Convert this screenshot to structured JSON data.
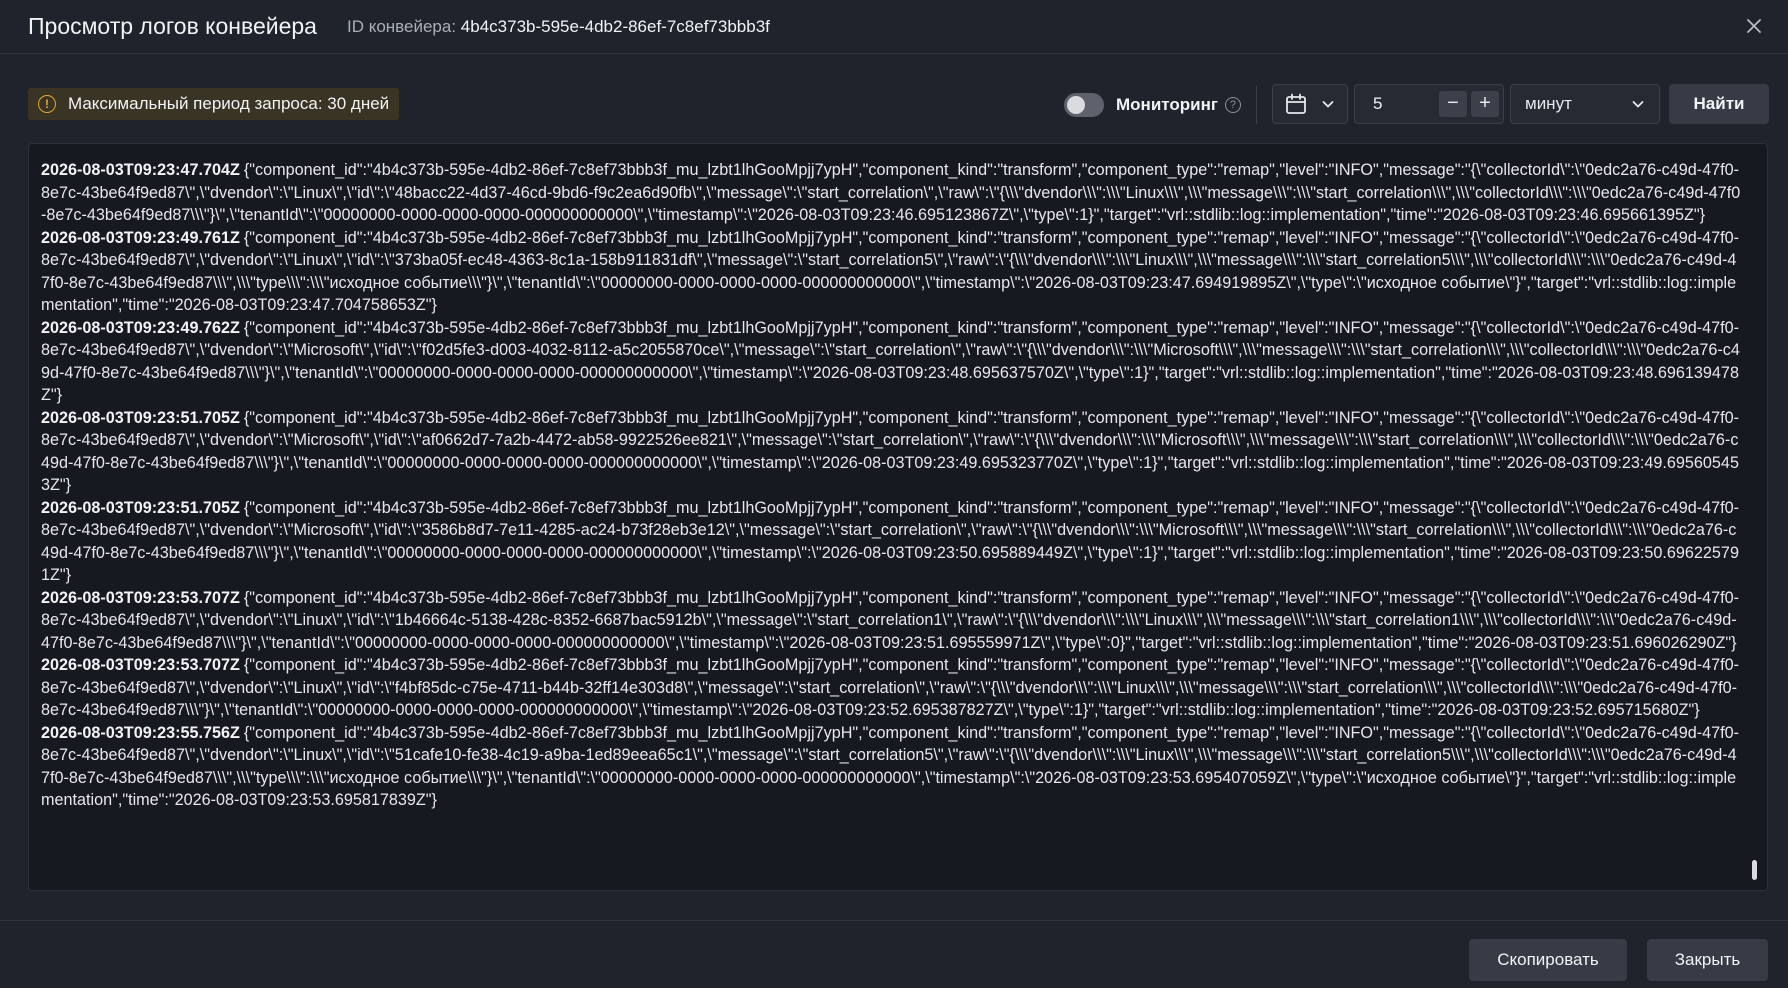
{
  "header": {
    "title": "Просмотр логов конвейера",
    "id_label": "ID конвейера:",
    "id_value": "4b4c373b-595e-4db2-86ef-7c8ef73bbb3f"
  },
  "toolbar": {
    "notice": "Максимальный период запроса: 30 дней",
    "monitoring_label": "Мониторинг",
    "monitoring_on": false,
    "interval_value": "5",
    "minus": "−",
    "plus": "+",
    "unit": "минут",
    "find": "Найти"
  },
  "logs": [
    {
      "ts": "2026-08-03T09:23:47.704Z",
      "text": "{\"component_id\":\"4b4c373b-595e-4db2-86ef-7c8ef73bbb3f_mu_lzbt1lhGooMpjj7ypH\",\"component_kind\":\"transform\",\"component_type\":\"remap\",\"level\":\"INFO\",\"message\":\"{\\\"collectorId\\\":\\\"0edc2a76-c49d-47f0-8e7c-43be64f9ed87\\\",\\\"dvendor\\\":\\\"Linux\\\",\\\"id\\\":\\\"48bacc22-4d37-46cd-9bd6-f9c2ea6d90fb\\\",\\\"message\\\":\\\"start_correlation\\\",\\\"raw\\\":\\\"{\\\\\\\"dvendor\\\\\\\":\\\\\\\"Linux\\\\\\\",\\\\\\\"message\\\\\\\":\\\\\\\"start_correlation\\\\\\\",\\\\\\\"collectorId\\\\\\\":\\\\\\\"0edc2a76-c49d-47f0-8e7c-43be64f9ed87\\\\\\\"}\\\",\\\"tenantId\\\":\\\"00000000-0000-0000-0000-000000000000\\\",\\\"timestamp\\\":\\\"2026-08-03T09:23:46.695123867Z\\\",\\\"type\\\":1}\",\"target\":\"vrl::stdlib::log::implementation\",\"time\":\"2026-08-03T09:23:46.695661395Z\"}"
    },
    {
      "ts": "2026-08-03T09:23:49.761Z",
      "text": "{\"component_id\":\"4b4c373b-595e-4db2-86ef-7c8ef73bbb3f_mu_lzbt1lhGooMpjj7ypH\",\"component_kind\":\"transform\",\"component_type\":\"remap\",\"level\":\"INFO\",\"message\":\"{\\\"collectorId\\\":\\\"0edc2a76-c49d-47f0-8e7c-43be64f9ed87\\\",\\\"dvendor\\\":\\\"Linux\\\",\\\"id\\\":\\\"373ba05f-ec48-4363-8c1a-158b911831df\\\",\\\"message\\\":\\\"start_correlation5\\\",\\\"raw\\\":\\\"{\\\\\\\"dvendor\\\\\\\":\\\\\\\"Linux\\\\\\\",\\\\\\\"message\\\\\\\":\\\\\\\"start_correlation5\\\\\\\",\\\\\\\"collectorId\\\\\\\":\\\\\\\"0edc2a76-c49d-47f0-8e7c-43be64f9ed87\\\\\\\",\\\\\\\"type\\\\\\\":\\\\\\\"исходное событие\\\\\\\"}\\\",\\\"tenantId\\\":\\\"00000000-0000-0000-0000-000000000000\\\",\\\"timestamp\\\":\\\"2026-08-03T09:23:47.694919895Z\\\",\\\"type\\\":\\\"исходное событие\\\"}\",\"target\":\"vrl::stdlib::log::implementation\",\"time\":\"2026-08-03T09:23:47.704758653Z\"}"
    },
    {
      "ts": "2026-08-03T09:23:49.762Z",
      "text": "{\"component_id\":\"4b4c373b-595e-4db2-86ef-7c8ef73bbb3f_mu_lzbt1lhGooMpjj7ypH\",\"component_kind\":\"transform\",\"component_type\":\"remap\",\"level\":\"INFO\",\"message\":\"{\\\"collectorId\\\":\\\"0edc2a76-c49d-47f0-8e7c-43be64f9ed87\\\",\\\"dvendor\\\":\\\"Microsoft\\\",\\\"id\\\":\\\"f02d5fe3-d003-4032-8112-a5c2055870ce\\\",\\\"message\\\":\\\"start_correlation\\\",\\\"raw\\\":\\\"{\\\\\\\"dvendor\\\\\\\":\\\\\\\"Microsoft\\\\\\\",\\\\\\\"message\\\\\\\":\\\\\\\"start_correlation\\\\\\\",\\\\\\\"collectorId\\\\\\\":\\\\\\\"0edc2a76-c49d-47f0-8e7c-43be64f9ed87\\\\\\\"}\\\",\\\"tenantId\\\":\\\"00000000-0000-0000-0000-000000000000\\\",\\\"timestamp\\\":\\\"2026-08-03T09:23:48.695637570Z\\\",\\\"type\\\":1}\",\"target\":\"vrl::stdlib::log::implementation\",\"time\":\"2026-08-03T09:23:48.696139478Z\"}"
    },
    {
      "ts": "2026-08-03T09:23:51.705Z",
      "text": "{\"component_id\":\"4b4c373b-595e-4db2-86ef-7c8ef73bbb3f_mu_lzbt1lhGooMpjj7ypH\",\"component_kind\":\"transform\",\"component_type\":\"remap\",\"level\":\"INFO\",\"message\":\"{\\\"collectorId\\\":\\\"0edc2a76-c49d-47f0-8e7c-43be64f9ed87\\\",\\\"dvendor\\\":\\\"Microsoft\\\",\\\"id\\\":\\\"af0662d7-7a2b-4472-ab58-9922526ee821\\\",\\\"message\\\":\\\"start_correlation\\\",\\\"raw\\\":\\\"{\\\\\\\"dvendor\\\\\\\":\\\\\\\"Microsoft\\\\\\\",\\\\\\\"message\\\\\\\":\\\\\\\"start_correlation\\\\\\\",\\\\\\\"collectorId\\\\\\\":\\\\\\\"0edc2a76-c49d-47f0-8e7c-43be64f9ed87\\\\\\\"}\\\",\\\"tenantId\\\":\\\"00000000-0000-0000-0000-000000000000\\\",\\\"timestamp\\\":\\\"2026-08-03T09:23:49.695323770Z\\\",\\\"type\\\":1}\",\"target\":\"vrl::stdlib::log::implementation\",\"time\":\"2026-08-03T09:23:49.695605453Z\"}"
    },
    {
      "ts": "2026-08-03T09:23:51.705Z",
      "text": "{\"component_id\":\"4b4c373b-595e-4db2-86ef-7c8ef73bbb3f_mu_lzbt1lhGooMpjj7ypH\",\"component_kind\":\"transform\",\"component_type\":\"remap\",\"level\":\"INFO\",\"message\":\"{\\\"collectorId\\\":\\\"0edc2a76-c49d-47f0-8e7c-43be64f9ed87\\\",\\\"dvendor\\\":\\\"Microsoft\\\",\\\"id\\\":\\\"3586b8d7-7e11-4285-ac24-b73f28eb3e12\\\",\\\"message\\\":\\\"start_correlation\\\",\\\"raw\\\":\\\"{\\\\\\\"dvendor\\\\\\\":\\\\\\\"Microsoft\\\\\\\",\\\\\\\"message\\\\\\\":\\\\\\\"start_correlation\\\\\\\",\\\\\\\"collectorId\\\\\\\":\\\\\\\"0edc2a76-c49d-47f0-8e7c-43be64f9ed87\\\\\\\"}\\\",\\\"tenantId\\\":\\\"00000000-0000-0000-0000-000000000000\\\",\\\"timestamp\\\":\\\"2026-08-03T09:23:50.695889449Z\\\",\\\"type\\\":1}\",\"target\":\"vrl::stdlib::log::implementation\",\"time\":\"2026-08-03T09:23:50.696225791Z\"}"
    },
    {
      "ts": "2026-08-03T09:23:53.707Z",
      "text": "{\"component_id\":\"4b4c373b-595e-4db2-86ef-7c8ef73bbb3f_mu_lzbt1lhGooMpjj7ypH\",\"component_kind\":\"transform\",\"component_type\":\"remap\",\"level\":\"INFO\",\"message\":\"{\\\"collectorId\\\":\\\"0edc2a76-c49d-47f0-8e7c-43be64f9ed87\\\",\\\"dvendor\\\":\\\"Linux\\\",\\\"id\\\":\\\"1b46664c-5138-428c-8352-6687bac5912b\\\",\\\"message\\\":\\\"start_correlation1\\\",\\\"raw\\\":\\\"{\\\\\\\"dvendor\\\\\\\":\\\\\\\"Linux\\\\\\\",\\\\\\\"message\\\\\\\":\\\\\\\"start_correlation1\\\\\\\",\\\\\\\"collectorId\\\\\\\":\\\\\\\"0edc2a76-c49d-47f0-8e7c-43be64f9ed87\\\\\\\"}\\\",\\\"tenantId\\\":\\\"00000000-0000-0000-0000-000000000000\\\",\\\"timestamp\\\":\\\"2026-08-03T09:23:51.695559971Z\\\",\\\"type\\\":0}\",\"target\":\"vrl::stdlib::log::implementation\",\"time\":\"2026-08-03T09:23:51.696026290Z\"}"
    },
    {
      "ts": "2026-08-03T09:23:53.707Z",
      "text": "{\"component_id\":\"4b4c373b-595e-4db2-86ef-7c8ef73bbb3f_mu_lzbt1lhGooMpjj7ypH\",\"component_kind\":\"transform\",\"component_type\":\"remap\",\"level\":\"INFO\",\"message\":\"{\\\"collectorId\\\":\\\"0edc2a76-c49d-47f0-8e7c-43be64f9ed87\\\",\\\"dvendor\\\":\\\"Linux\\\",\\\"id\\\":\\\"f4bf85dc-c75e-4711-b44b-32ff14e303d8\\\",\\\"message\\\":\\\"start_correlation\\\",\\\"raw\\\":\\\"{\\\\\\\"dvendor\\\\\\\":\\\\\\\"Linux\\\\\\\",\\\\\\\"message\\\\\\\":\\\\\\\"start_correlation\\\\\\\",\\\\\\\"collectorId\\\\\\\":\\\\\\\"0edc2a76-c49d-47f0-8e7c-43be64f9ed87\\\\\\\"}\\\",\\\"tenantId\\\":\\\"00000000-0000-0000-0000-000000000000\\\",\\\"timestamp\\\":\\\"2026-08-03T09:23:52.695387827Z\\\",\\\"type\\\":1}\",\"target\":\"vrl::stdlib::log::implementation\",\"time\":\"2026-08-03T09:23:52.695715680Z\"}"
    },
    {
      "ts": "2026-08-03T09:23:55.756Z",
      "text": "{\"component_id\":\"4b4c373b-595e-4db2-86ef-7c8ef73bbb3f_mu_lzbt1lhGooMpjj7ypH\",\"component_kind\":\"transform\",\"component_type\":\"remap\",\"level\":\"INFO\",\"message\":\"{\\\"collectorId\\\":\\\"0edc2a76-c49d-47f0-8e7c-43be64f9ed87\\\",\\\"dvendor\\\":\\\"Linux\\\",\\\"id\\\":\\\"51cafe10-fe38-4c19-a9ba-1ed89eea65c1\\\",\\\"message\\\":\\\"start_correlation5\\\",\\\"raw\\\":\\\"{\\\\\\\"dvendor\\\\\\\":\\\\\\\"Linux\\\\\\\",\\\\\\\"message\\\\\\\":\\\\\\\"start_correlation5\\\\\\\",\\\\\\\"collectorId\\\\\\\":\\\\\\\"0edc2a76-c49d-47f0-8e7c-43be64f9ed87\\\\\\\",\\\\\\\"type\\\\\\\":\\\\\\\"исходное событие\\\\\\\"}\\\",\\\"tenantId\\\":\\\"00000000-0000-0000-0000-000000000000\\\",\\\"timestamp\\\":\\\"2026-08-03T09:23:53.695407059Z\\\",\\\"type\\\":\\\"исходное событие\\\"}\",\"target\":\"vrl::stdlib::log::implementation\",\"time\":\"2026-08-03T09:23:53.695817839Z\"}"
    }
  ],
  "footer": {
    "copy": "Скопировать",
    "close": "Закрыть"
  }
}
